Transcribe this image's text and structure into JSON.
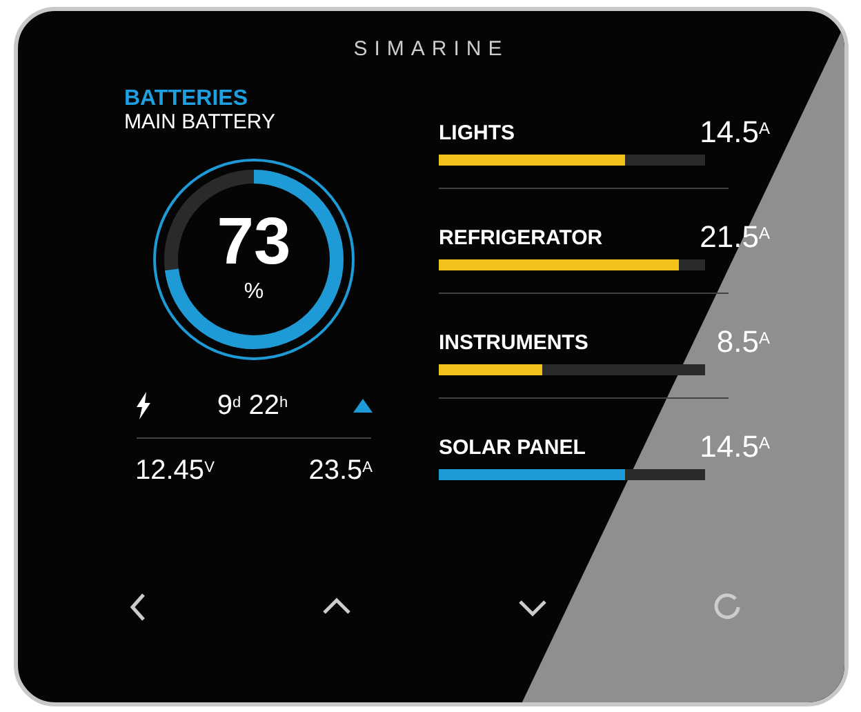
{
  "brand": "SIMARINE",
  "battery": {
    "title": "BATTERIES",
    "subtitle": "MAIN BATTERY",
    "level": 0.73,
    "value": "73",
    "unit": "%",
    "time_left": "9$^{d}$ 22$^{h}$",
    "voltage": "12.45$^{V}$",
    "current": "23.5$^{A}$"
  },
  "loads": [
    {
      "name": "LIGHTS",
      "reading": "14.5$^{A}$",
      "level": 0.7,
      "color": "#f2c21b"
    },
    {
      "name": "REFRIGERATOR",
      "reading": "21.5$^{A}$",
      "level": 0.9,
      "color": "#f2c21b"
    },
    {
      "name": "INSTRUMENTS",
      "reading": "8.5$^{A}$",
      "level": 0.39,
      "color": "#f2c21b"
    },
    {
      "name": "SOLAR PANEL",
      "reading": "14.5$^{A}$",
      "level": 0.7,
      "color": "#1e9ad6"
    }
  ],
  "buttons": [
    {
      "kind": "left"
    },
    {
      "kind": "up"
    },
    {
      "kind": "down"
    },
    {
      "kind": "circle"
    }
  ]
}
